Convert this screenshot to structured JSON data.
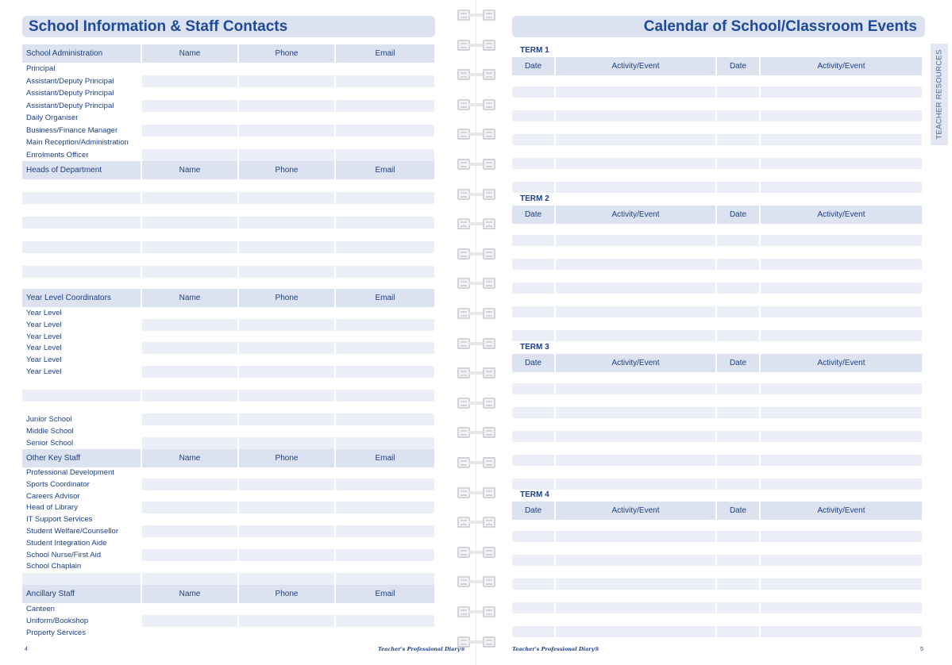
{
  "left": {
    "title": "School Information & Staff Contacts",
    "columns": {
      "name": "Name",
      "phone": "Phone",
      "email": "Email"
    },
    "sections": {
      "admin": {
        "heading": "School Administration",
        "rows": [
          "Principal",
          "Assistant/Deputy Principal",
          "Assistant/Deputy Principal",
          "Assistant/Deputy Principal",
          "Daily Organiser",
          "Business/Finance Manager",
          "Main Reception/Administration",
          "Enrolments Officer"
        ]
      },
      "heads": {
        "heading": "Heads of Department"
      },
      "year": {
        "heading": "Year Level Coordinators",
        "rows": [
          "Year Level",
          "Year Level",
          "Year Level",
          "Year Level",
          "Year Level",
          "Year Level"
        ],
        "school_rows": [
          "Junior School",
          "Middle School",
          "Senior School"
        ]
      },
      "other": {
        "heading": "Other Key Staff",
        "rows": [
          "Professional Development",
          "Sports Coordinator",
          "Careers Advisor",
          "Head of Library",
          "IT Support Services",
          "Student Welfare/Counsellor",
          "Student Integration Aide",
          "School Nurse/First Aid",
          "School Chaplain"
        ]
      },
      "ancillary": {
        "heading": "Ancillary Staff",
        "rows": [
          "Canteen",
          "Uniform/Bookshop",
          "Property Services"
        ]
      }
    },
    "page_number": "4",
    "brand": "Teacher's Professional Diary®"
  },
  "right": {
    "title": "Calendar of School/Classroom Events",
    "columns": {
      "date": "Date",
      "activity": "Activity/Event"
    },
    "terms": [
      "TERM 1",
      "TERM 2",
      "TERM 3",
      "TERM 4"
    ],
    "side_tab": "TEACHER RESOURCES",
    "page_number": "5",
    "brand": "Teacher's Professional Diary®"
  }
}
